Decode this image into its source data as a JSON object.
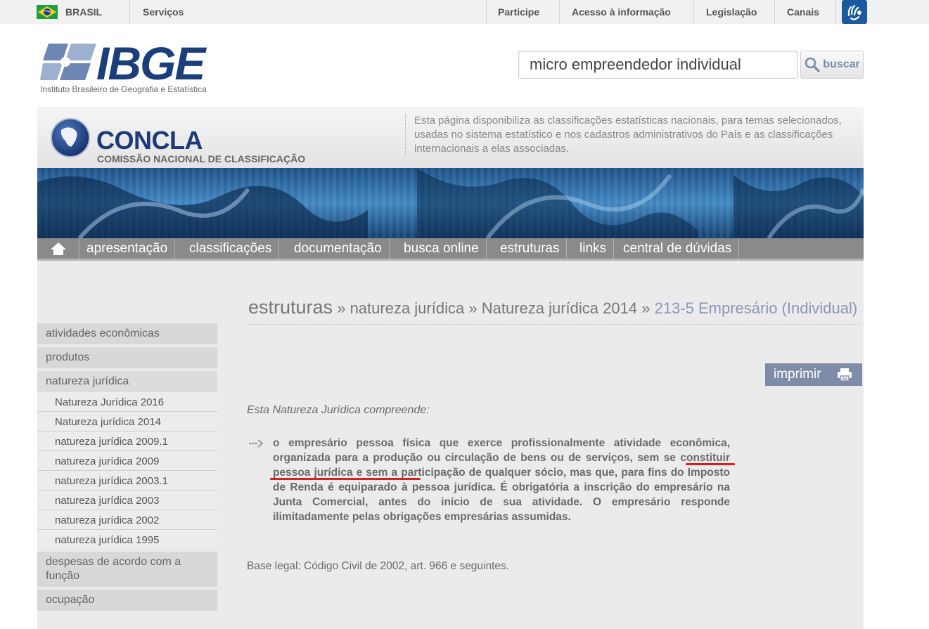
{
  "govbar": {
    "country": "BRASIL",
    "services": "Serviços",
    "links": [
      "Participe",
      "Acesso à informação",
      "Legislação",
      "Canais"
    ]
  },
  "header": {
    "logo_word": "IBGE",
    "logo_subtitle": "Instituto Brasileiro de Geografia e Estatística",
    "search_value": "micro empreendedor individual",
    "search_button": "buscar"
  },
  "concla": {
    "name": "CONCLA",
    "full_name": "COMISSÃO NACIONAL DE CLASSIFICAÇÃO",
    "description": "Esta página disponibiliza as classificações estatísticas nacionais, para temas selecionados, usadas no sistema estatístico e nos cadastros administrativos do País e as classificações internacionais a elas associadas."
  },
  "nav": {
    "items": [
      "apresentação",
      "classificações",
      "documentação",
      "busca online",
      "estruturas",
      "links",
      "central de dúvidas"
    ]
  },
  "sidebar": {
    "categories_top": [
      "atividades econômicas",
      "produtos",
      "natureza jurídica"
    ],
    "subitems": [
      "Natureza Jurídica 2016",
      "Natureza jurídica 2014",
      "natureza jurídica 2009.1",
      "natureza jurídica 2009",
      "natureza jurídica 2003.1",
      "natureza jurídica 2003",
      "natureza jurídica 2002",
      "natureza jurídica 1995"
    ],
    "categories_bottom": [
      "despesas de acordo com a função",
      "ocupação"
    ]
  },
  "breadcrumb": {
    "root": "estruturas",
    "sep": "»",
    "level1": "natureza jurídica",
    "level2": "Natureza jurídica 2014",
    "current": "213-5 Empresário (Individual)"
  },
  "content": {
    "print_label": "imprimir",
    "intro": "Esta Natureza Jurídica compreende:",
    "desc_part1": "o empresário pessoa física que exerce profissionalmente atividade econômica, organizada para a produção ou circulação de bens ou de serviços, ",
    "desc_highlight": "sem se constituir pessoa jurídica",
    "desc_part2": " e sem a participação de qualquer sócio, mas que, para fins do Imposto de Renda é equiparado à pessoa jurídica. É obrigatória a inscrição do empresário na Junta Comercial, antes do início de sua atividade. O empresário responde ilimitadamente pelas obrigações empresárias assumidas.",
    "legal": "Base legal: Código Civil de 2002, art. 966 e seguintes."
  },
  "colors": {
    "accent_blue": "#1c3a78",
    "nav_gray": "#8a8a8a",
    "highlight_red": "#d42020",
    "breadcrumb_current": "#8a97b6"
  }
}
